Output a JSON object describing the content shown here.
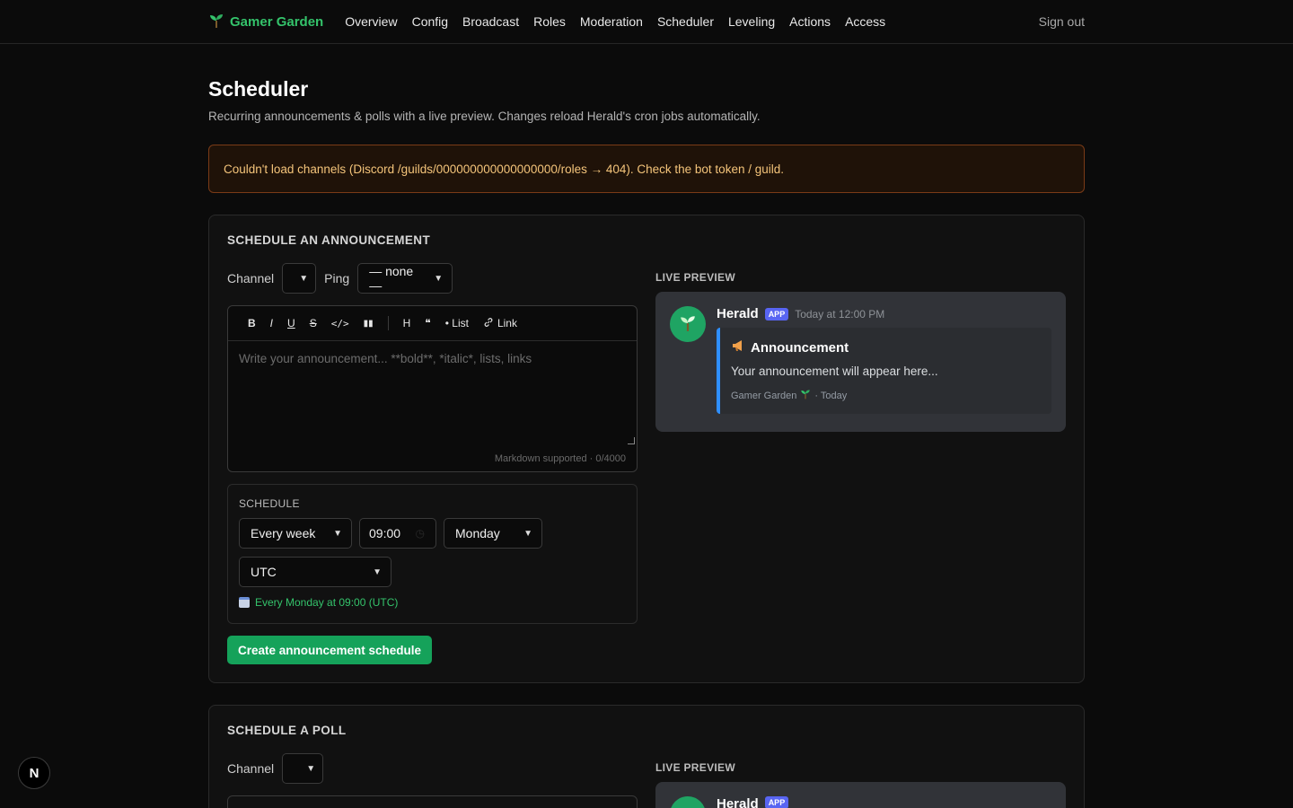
{
  "brand": {
    "name": "Gamer Garden",
    "icon": "sprout-icon"
  },
  "nav": [
    "Overview",
    "Config",
    "Broadcast",
    "Roles",
    "Moderation",
    "Scheduler",
    "Leveling",
    "Actions",
    "Access"
  ],
  "signout": "Sign out",
  "page": {
    "title": "Scheduler",
    "subtitle": "Recurring announcements & polls with a live preview. Changes reload Herald's cron jobs automatically."
  },
  "alert": "Couldn't load channels (Discord /guilds/000000000000000000/roles → 404). Check the bot token / guild.",
  "announcement": {
    "title": "SCHEDULE AN ANNOUNCEMENT",
    "channel_label": "Channel",
    "channel_value": "",
    "ping_label": "Ping",
    "ping_value": "— none —",
    "toolbar": {
      "bold": "B",
      "italic": "I",
      "underline": "U",
      "strike": "S",
      "code": "</>",
      "spoiler": "▮▮",
      "heading": "H",
      "quote": "❝",
      "list": "• List",
      "link": "Link"
    },
    "placeholder": "Write your announcement... **bold**, *italic*, lists, links",
    "footer": "Markdown supported · 0/4000",
    "schedule": {
      "label": "SCHEDULE",
      "frequency": "Every week",
      "time": "09:00",
      "day": "Monday",
      "timezone": "UTC",
      "summary": "Every Monday at 09:00 (UTC)"
    },
    "submit": "Create announcement schedule",
    "preview": {
      "label": "LIVE PREVIEW",
      "author": "Herald",
      "badge": "APP",
      "timestamp": "Today at 12:00 PM",
      "embed_title": "Announcement",
      "embed_desc": "Your announcement will appear here...",
      "embed_footer": "Gamer Garden",
      "embed_footer_time": "· Today"
    }
  },
  "poll": {
    "title": "SCHEDULE A POLL",
    "channel_label": "Channel",
    "preview_label": "LIVE PREVIEW",
    "author": "Herald",
    "badge": "APP"
  },
  "dev_badge": "N",
  "colors": {
    "accent": "#34c36b",
    "button": "#15a25a",
    "alert_text": "#f4c47a",
    "embed_bar": "#2f8fff"
  }
}
